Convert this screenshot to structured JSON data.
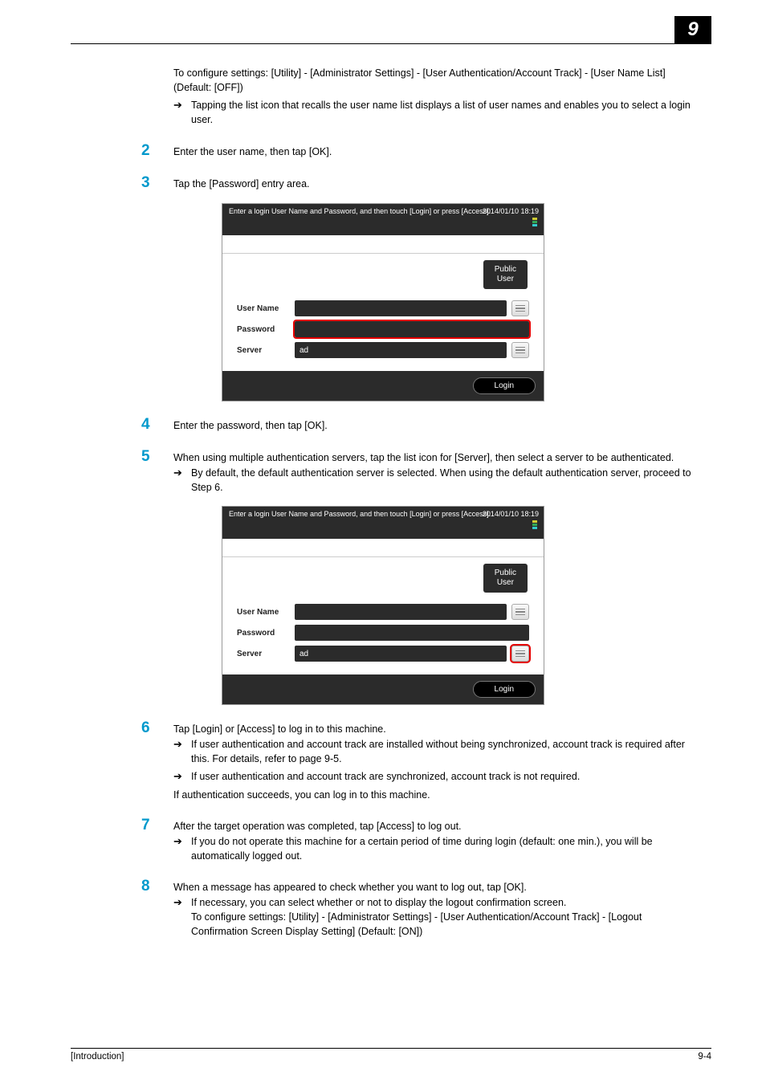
{
  "header": {
    "chapter_number": "9"
  },
  "intro": {
    "configure_line": "To configure settings: [Utility] - [Administrator Settings] - [User Authentication/Account Track] - [User Name List] (Default: [OFF])",
    "list_icon_line": "Tapping the list icon that recalls the user name list displays a list of user names and enables you to select a login user."
  },
  "step2": {
    "num": "2",
    "text": "Enter the user name, then tap [OK]."
  },
  "step3": {
    "num": "3",
    "text": "Tap the [Password] entry area."
  },
  "screenshot_common": {
    "instruction": "Enter a login User Name and Password, and then touch [Login] or press [Access].",
    "date": "2014/01/10",
    "time": "18:19",
    "public_user_line1": "Public",
    "public_user_line2": "User",
    "label_user": "User Name",
    "label_password": "Password",
    "label_server": "Server",
    "server_value": "ad",
    "login_button": "Login"
  },
  "step4": {
    "num": "4",
    "text": "Enter the password, then tap [OK]."
  },
  "step5": {
    "num": "5",
    "text": "When using multiple authentication servers, tap the list icon for [Server], then select a server to be authenticated.",
    "bullet": "By default, the default authentication server is selected. When using the default authentication server, proceed to Step 6."
  },
  "step6": {
    "num": "6",
    "text": "Tap [Login] or [Access] to log in to this machine.",
    "bullet1": "If user authentication and account track are installed without being synchronized, account track is required after this. For details, refer to page 9-5.",
    "bullet2": "If user authentication and account track are synchronized, account track is not required.",
    "tail": "If authentication succeeds, you can log in to this machine."
  },
  "step7": {
    "num": "7",
    "text": "After the target operation was completed, tap [Access] to log out.",
    "bullet": "If you do not operate this machine for a certain period of time during login (default: one min.), you will be automatically logged out."
  },
  "step8": {
    "num": "8",
    "text": "When a message has appeared to check whether you want to log out, tap [OK].",
    "bullet": "If necessary, you can select whether or not to display the logout confirmation screen.\nTo configure settings: [Utility] - [Administrator Settings] - [User Authentication/Account Track] - [Logout Confirmation Screen Display Setting] (Default: [ON])"
  },
  "footer": {
    "left": "[Introduction]",
    "right": "9-4"
  }
}
